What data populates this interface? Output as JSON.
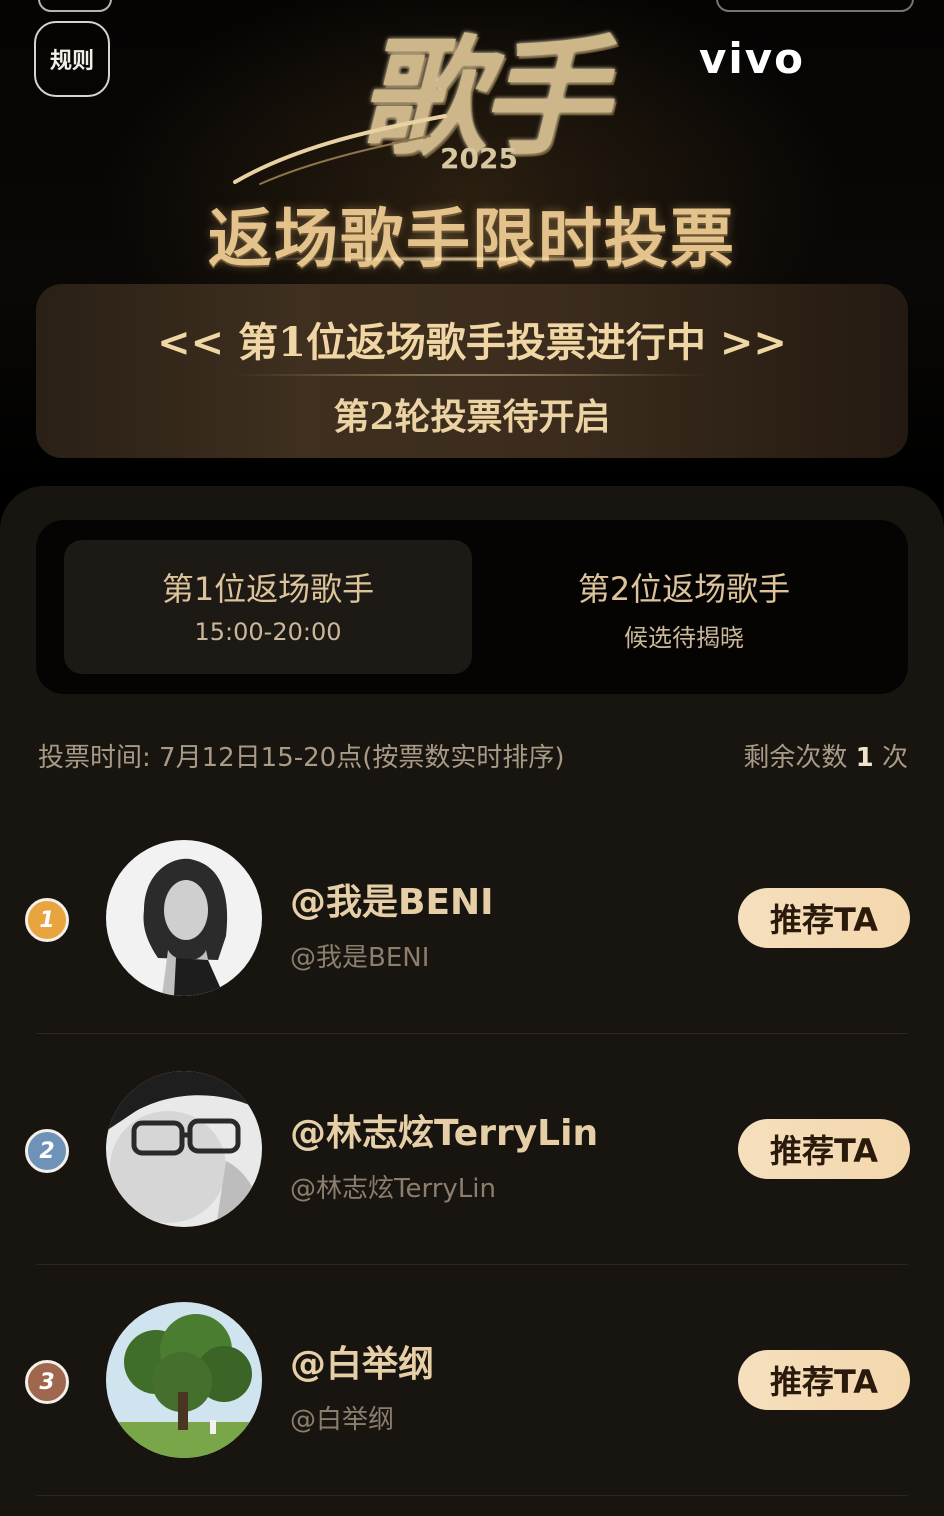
{
  "header": {
    "rules_label": "规则",
    "brand": "vivo",
    "show_logo": "歌手",
    "show_year": "2025",
    "title": "返场歌手限时投票"
  },
  "status": {
    "line1": "<< 第1位返场歌手投票进行中 >>",
    "line2": "第2轮投票待开启"
  },
  "tabs": [
    {
      "label": "第1位返场歌手",
      "sub": "15:00-20:00",
      "active": true
    },
    {
      "label": "第2位返场歌手",
      "sub": "候选待揭晓",
      "active": false
    }
  ],
  "vote": {
    "info": "投票时间: 7月12日15-20点(按票数实时排序)",
    "remaining_prefix": "剩余次数",
    "remaining_count": "1",
    "remaining_suffix": "次"
  },
  "candidates": [
    {
      "rank": "1",
      "name": "@我是BENI",
      "handle": "@我是BENI",
      "button": "推荐TA"
    },
    {
      "rank": "2",
      "name": "@林志炫TerryLin",
      "handle": "@林志炫TerryLin",
      "button": "推荐TA"
    },
    {
      "rank": "3",
      "name": "@白举纲",
      "handle": "@白举纲",
      "button": "推荐TA"
    }
  ],
  "colors": {
    "gold_text": "#e3c38b",
    "button_bg": "#f5dfbd",
    "rank_1": "#e8a43f",
    "rank_2": "#6f93b8",
    "rank_3": "#a0674f"
  }
}
